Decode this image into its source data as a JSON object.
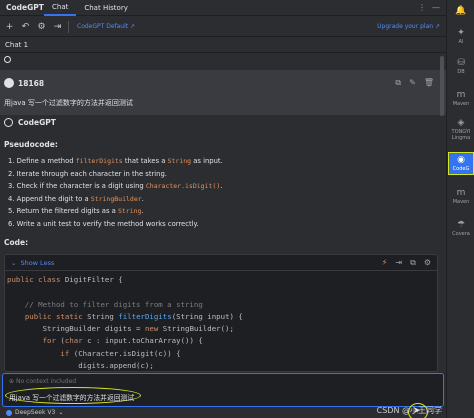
{
  "app": {
    "title": "CodeGPT"
  },
  "tabs": [
    {
      "label": "Chat"
    },
    {
      "label": "Chat History"
    }
  ],
  "toolbar": {
    "model_link": "CodeGPT Default ↗",
    "upgrade_link": "Upgrade your plan ↗"
  },
  "chat": {
    "label": "Chat 1"
  },
  "user_message": {
    "name": "18168",
    "text": "用java 写一个过滤数字的方法并返回测试"
  },
  "bot": {
    "name": "CodeGPT",
    "pseudocode_title": "Pseudocode:",
    "steps": [
      {
        "num": "1.",
        "before": "Define a method ",
        "code": "filterDigits",
        "after": " that takes a ",
        "code2": "String",
        "after2": " as input."
      },
      {
        "num": "2.",
        "before": "Iterate through each character in the string.",
        "code": "",
        "after": "",
        "code2": "",
        "after2": ""
      },
      {
        "num": "3.",
        "before": "Check if the character is a digit using ",
        "code": "Character.isDigit()",
        "after": ".",
        "code2": "",
        "after2": ""
      },
      {
        "num": "4.",
        "before": "Append the digit to a ",
        "code": "StringBuilder",
        "after": ".",
        "code2": "",
        "after2": ""
      },
      {
        "num": "5.",
        "before": "Return the filtered digits as a ",
        "code": "String",
        "after": ".",
        "code2": "",
        "after2": ""
      },
      {
        "num": "6.",
        "before": "Write a unit test to verify the method works correctly.",
        "code": "",
        "after": "",
        "code2": "",
        "after2": ""
      }
    ],
    "code_title": "Code:",
    "show_less": "Show Less"
  },
  "code_lines": [
    "public class DigitFilter {",
    "",
    "    // Method to filter digits from a string",
    "    public static String filterDigits(String input) {",
    "        StringBuilder digits = new StringBuilder();",
    "        for (char c : input.toCharArray()) {",
    "            if (Character.isDigit(c)) {",
    "                digits.append(c);"
  ],
  "input": {
    "context_placeholder": "No context included",
    "text": "用java 写一个过滤数字的方法并返回测试",
    "model": "DeepSeek V3"
  },
  "watermark": "CSDN @小王同学",
  "sidebar": [
    {
      "label": "Notifications",
      "icon": "bell-icon"
    },
    {
      "label": "AI",
      "icon": "ai-icon"
    },
    {
      "label": "DB",
      "icon": "database-icon"
    },
    {
      "label": "Maven",
      "icon": "maven-icon"
    },
    {
      "label": "TONGYI Lingma",
      "icon": "lingma-icon"
    },
    {
      "label": "CodeG",
      "icon": "codegpt-icon"
    },
    {
      "label": "Maven",
      "icon": "maven-icon"
    },
    {
      "label": "Covera",
      "icon": "coverage-icon"
    }
  ],
  "colors": {
    "accent": "#3574f0",
    "highlight": "#d4e620",
    "code_orange": "#e8925b",
    "link": "#548af7"
  }
}
